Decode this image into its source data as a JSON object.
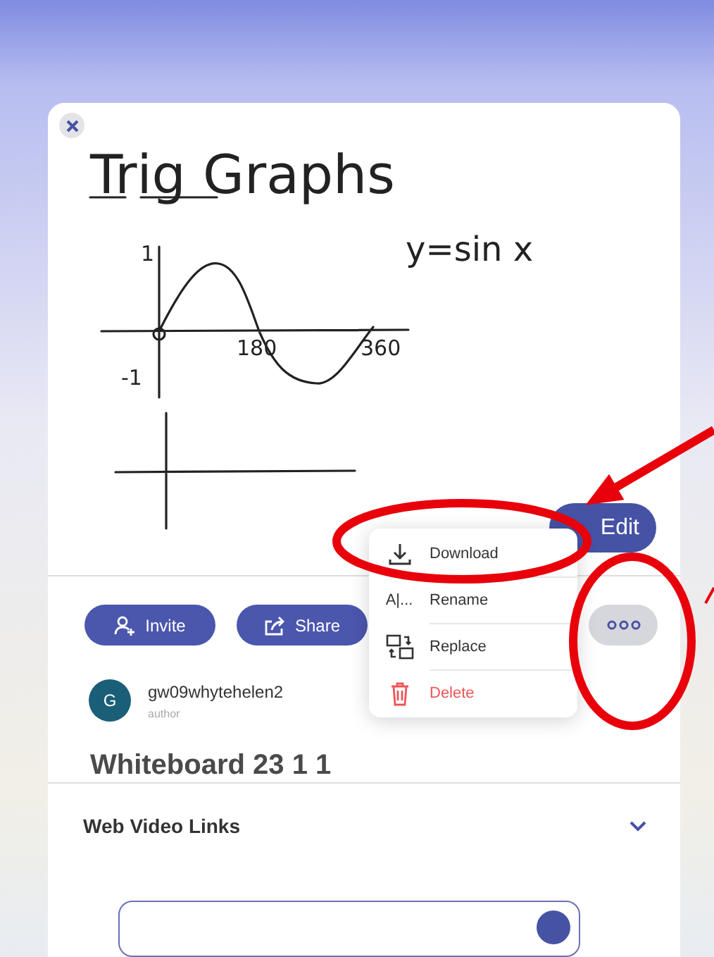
{
  "whiteboard": {
    "notes": [
      {
        "kind": "title",
        "text": "Trig Graphs"
      },
      {
        "kind": "equation",
        "text": "y=sin x"
      },
      {
        "kind": "y-max",
        "text": "1"
      },
      {
        "kind": "y-min",
        "text": "-1"
      },
      {
        "kind": "x-mid",
        "text": "180"
      },
      {
        "kind": "x-end",
        "text": "360"
      }
    ],
    "edit_button": {
      "label": "Edit"
    }
  },
  "actions": [
    {
      "kind": "invite",
      "label": "Invite"
    },
    {
      "kind": "share",
      "label": "Share"
    }
  ],
  "menu": {
    "items": [
      {
        "kind": "download",
        "label": "Download",
        "danger": false
      },
      {
        "kind": "rename",
        "label": "Rename",
        "glyph": "A|...",
        "danger": false
      },
      {
        "kind": "replace",
        "label": "Replace",
        "danger": false
      },
      {
        "kind": "delete",
        "label": "Delete",
        "danger": true
      }
    ]
  },
  "author": {
    "initial": "G",
    "name": "gw09whytehelen2",
    "role": "author"
  },
  "title": "Whiteboard 23 1 1",
  "sections": [
    {
      "label": "Web Video Links",
      "expanded": false
    }
  ]
}
